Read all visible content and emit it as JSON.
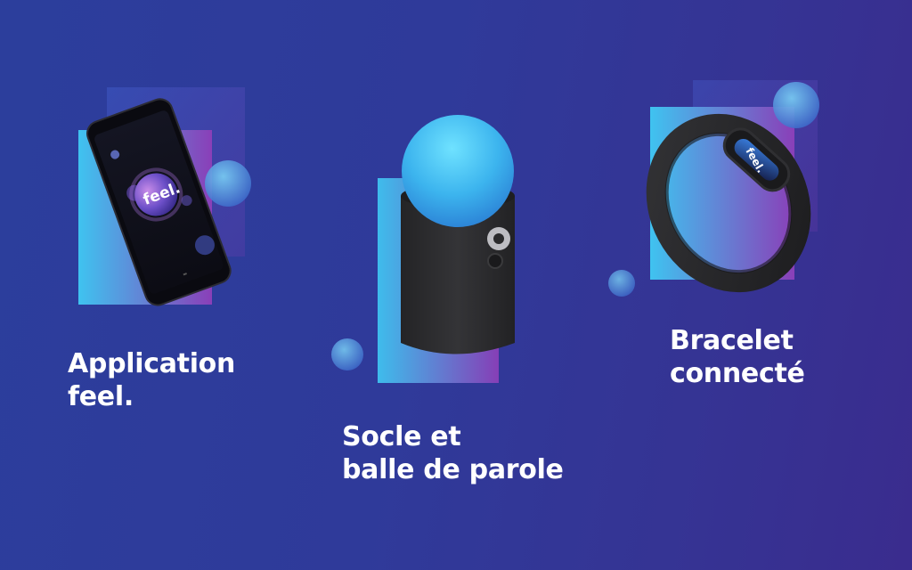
{
  "products": [
    {
      "id": "app",
      "caption_lines": [
        "Application",
        "feel."
      ],
      "screen_logo": "feel."
    },
    {
      "id": "base",
      "caption_lines": [
        "Socle et",
        "balle de parole"
      ]
    },
    {
      "id": "bracelet",
      "caption_lines": [
        "Bracelet",
        "connecté"
      ],
      "screen_logo": "feel."
    }
  ],
  "colors": {
    "background_left": "#2c3e9c",
    "background_right": "#3a2c8e",
    "accent_cyan": "#3fc3f0",
    "accent_magenta": "#8a3fb8",
    "device_body": "#2a2a2c",
    "text": "#ffffff"
  },
  "icons": [
    "phone-illustration",
    "speaking-ball-illustration",
    "bracelet-illustration"
  ]
}
